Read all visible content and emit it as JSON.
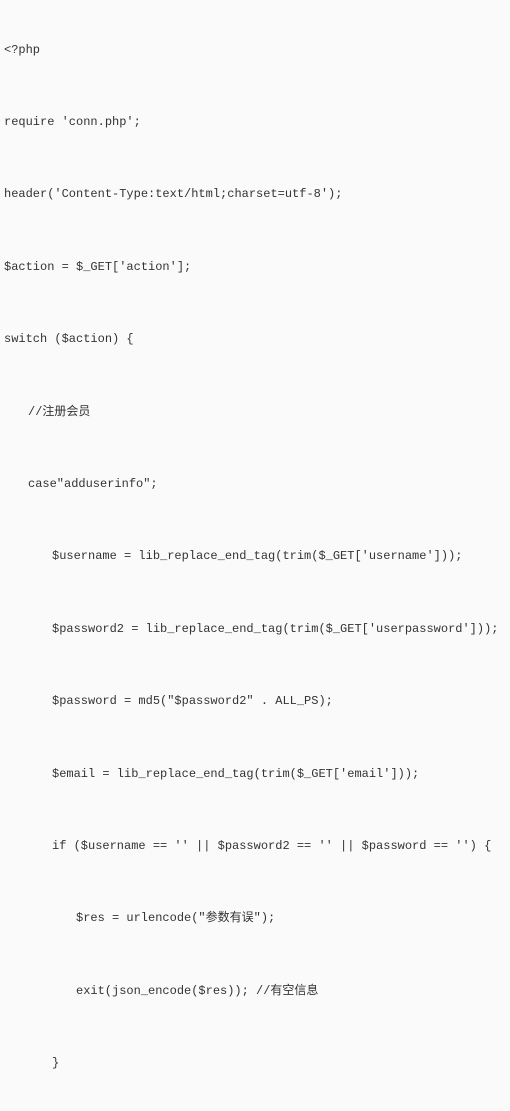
{
  "code": {
    "lines": [
      {
        "indent": 0,
        "text": "<?php"
      },
      {
        "indent": 0,
        "text": "require 'conn.php';"
      },
      {
        "indent": 0,
        "text": "header('Content-Type:text/html;charset=utf-8');"
      },
      {
        "indent": 0,
        "text": "$action = $_GET['action'];"
      },
      {
        "indent": 0,
        "text": "switch ($action) {"
      },
      {
        "indent": 1,
        "text": "//注册会员"
      },
      {
        "indent": 1,
        "text": "case\"adduserinfo\";"
      },
      {
        "indent": 2,
        "text": "$username = lib_replace_end_tag(trim($_GET['username']));"
      },
      {
        "indent": 2,
        "text": "$password2 = lib_replace_end_tag(trim($_GET['userpassword']));"
      },
      {
        "indent": 2,
        "text": "$password = md5(\"$password2\" . ALL_PS);"
      },
      {
        "indent": 2,
        "text": "$email = lib_replace_end_tag(trim($_GET['email']));"
      },
      {
        "indent": 2,
        "text": "if ($username == '' || $password2 == '' || $password == '') {"
      },
      {
        "indent": 3,
        "text": "$res = urlencode(\"参数有误\");"
      },
      {
        "indent": 3,
        "text": "exit(json_encode($res)); //有空信息"
      },
      {
        "indent": 2,
        "text": "}"
      }
    ]
  }
}
